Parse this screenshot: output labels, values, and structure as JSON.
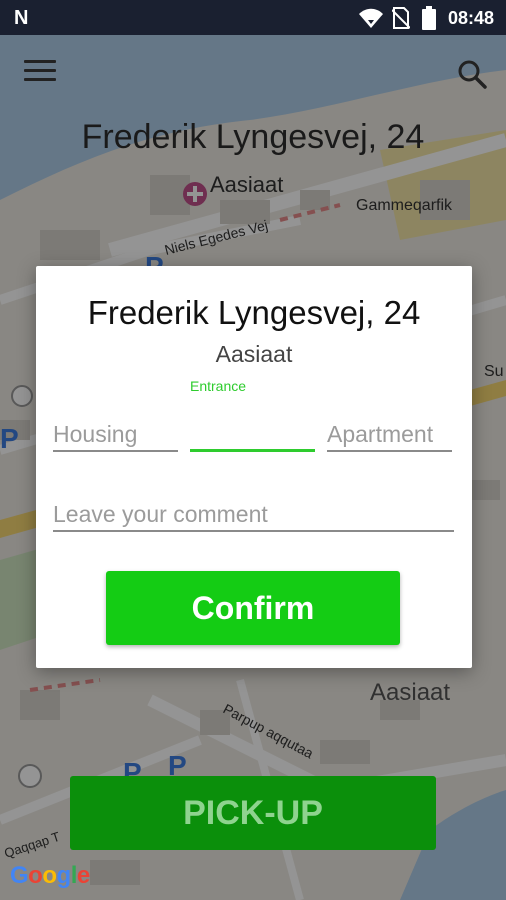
{
  "status_bar": {
    "time": "08:48",
    "left_icon": "n-logo",
    "icons": [
      "wifi-signal-icon",
      "no-sim-icon",
      "battery-icon"
    ]
  },
  "map": {
    "labels": {
      "town_top": "Aasiaat",
      "gammeqarfik": "Gammeqarfik",
      "niels_egedes_vej": "Niels Egedes Vej",
      "town_bottom": "Aasiaat",
      "parpup": "Parpup aqqutaa",
      "qaqqap": "Qaqqap T",
      "su": "Su"
    },
    "google_logo": "Google"
  },
  "header": {
    "address": "Frederik Lyngesvej, 24",
    "menu_icon": "hamburger-menu-icon",
    "search_icon": "search-icon"
  },
  "dialog": {
    "title": "Frederik Lyngesvej, 24",
    "city": "Aasiaat",
    "housing": {
      "placeholder": "Housing",
      "value": ""
    },
    "entrance": {
      "label": "Entrance",
      "value": ""
    },
    "apartment": {
      "placeholder": "Apartment",
      "value": ""
    },
    "comment": {
      "placeholder": "Leave your comment",
      "value": ""
    },
    "confirm_label": "Confirm"
  },
  "pickup_label": "PICK-UP",
  "colors": {
    "accent_green": "#14cc14",
    "field_active": "#2ecc2e",
    "pickup_green": "#0b8f0b",
    "status_bar": "#1a2030"
  }
}
